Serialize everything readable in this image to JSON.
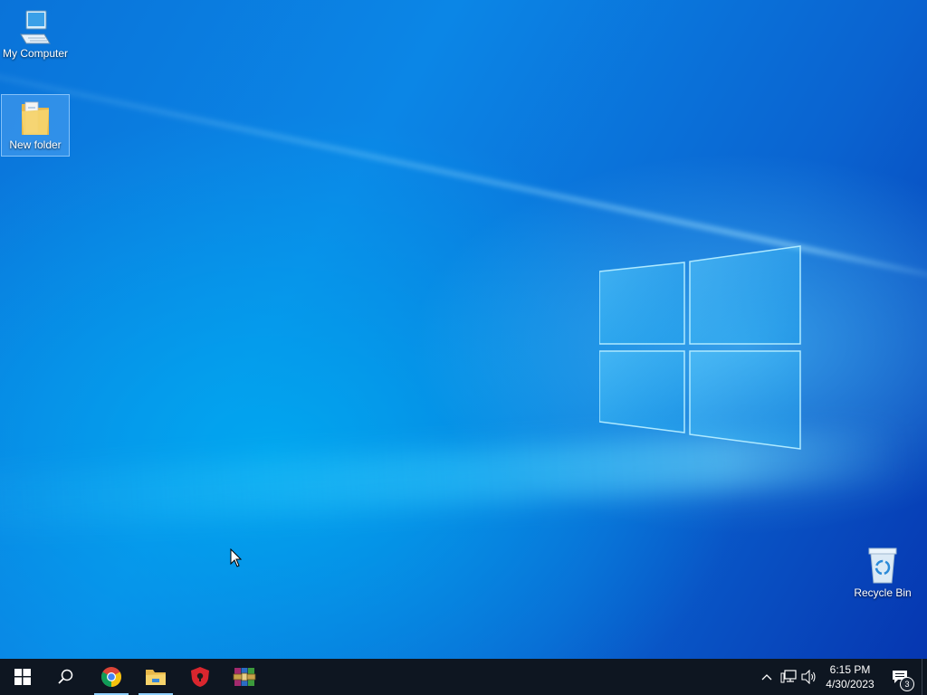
{
  "desktop": {
    "icons": [
      {
        "label": "My Computer",
        "icon": "computer-icon"
      },
      {
        "label": "New folder",
        "icon": "folder-icon"
      },
      {
        "label": "Recycle Bin",
        "icon": "recycle-bin-icon"
      }
    ]
  },
  "taskbar": {
    "apps": [
      {
        "name": "start-button",
        "icon": "windows-logo-icon"
      },
      {
        "name": "search-button",
        "icon": "search-icon"
      },
      {
        "name": "chrome",
        "icon": "chrome-icon",
        "running": true
      },
      {
        "name": "file-explorer",
        "icon": "folder-icon",
        "running": true
      },
      {
        "name": "security-app",
        "icon": "shield-icon"
      },
      {
        "name": "winrar",
        "icon": "winrar-icon"
      }
    ],
    "tray": {
      "icons": [
        "chevron-up-icon",
        "network-icon",
        "volume-icon"
      ],
      "time": "6:15 PM",
      "date": "4/30/2023",
      "notification_count": "3"
    }
  },
  "colors": {
    "taskbar": "#0e1621",
    "wallpaper_accent": "#0a73d9"
  }
}
